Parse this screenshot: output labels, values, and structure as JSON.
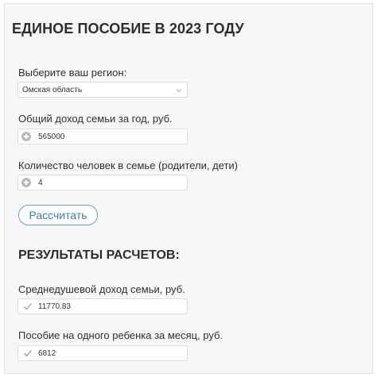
{
  "title": "ЕДИНОЕ ПОСОБИЕ В 2023 ГОДУ",
  "region": {
    "label": "Выберите ваш регион:",
    "value": "Омская область"
  },
  "income": {
    "label": "Общий доход семьи за год, руб.",
    "value": "565000"
  },
  "members": {
    "label": "Количество человек в семье (родители, дети)",
    "value": "4"
  },
  "calculate_label": "Рассчитать",
  "results": {
    "title": "РЕЗУЛЬТАТЫ РАСЧЕТОВ:",
    "per_capita": {
      "label": "Среднедушевой доход семьи, руб.",
      "value": "11770.83"
    },
    "per_child": {
      "label": "Пособие на одного ребенка за месяц, руб.",
      "value": "6812"
    }
  },
  "icons": {
    "chevron": "chevron-down-icon",
    "plus": "plus-circle-icon",
    "check": "check-icon"
  },
  "colors": {
    "accent": "#3d7fa8",
    "panel_bg": "#f8f6f6"
  }
}
